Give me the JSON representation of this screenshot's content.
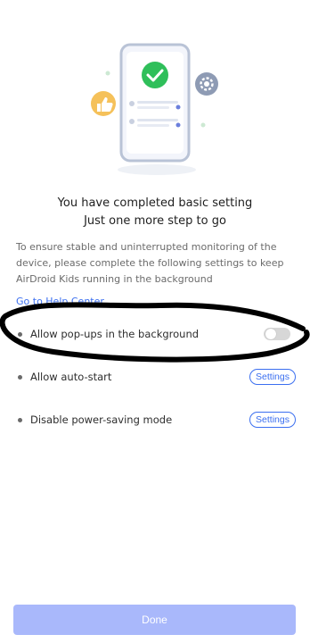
{
  "header": {
    "title_line1": "You have completed basic setting",
    "title_line2": "Just one more step to go"
  },
  "description": "To ensure stable and uninterrupted monitoring of the device, please complete the following settings to keep AirDroid Kids running in the background",
  "help_link": "Go to Help Center",
  "settings": [
    {
      "label": "Allow pop-ups in the background",
      "control": "toggle",
      "state": "off"
    },
    {
      "label": "Allow auto-start",
      "control": "button",
      "button_label": "Settings"
    },
    {
      "label": "Disable power-saving mode",
      "control": "button",
      "button_label": "Settings"
    }
  ],
  "done_label": "Done",
  "colors": {
    "accent": "#3b6ff0",
    "check_green": "#2fbf5a",
    "like_badge": "#f5c15a",
    "gear_badge": "#8e9bb4",
    "done_button": "#a9b8fb",
    "scribble": "#000000"
  },
  "icons": [
    "checkmark-icon",
    "thumbs-up-icon",
    "gear-icon"
  ]
}
